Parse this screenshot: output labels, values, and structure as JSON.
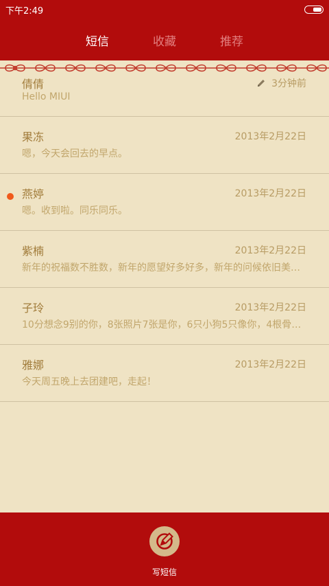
{
  "status_bar": {
    "time": "下午2:49"
  },
  "tabs": [
    {
      "label": "短信",
      "active": true
    },
    {
      "label": "收藏",
      "active": false
    },
    {
      "label": "推荐",
      "active": false
    }
  ],
  "conversations": [
    {
      "name": "倩倩",
      "time": "3分钟前",
      "preview": "Hello MIUI",
      "draft": true,
      "unread": false
    },
    {
      "name": "果冻",
      "time": "2013年2月22日",
      "preview": "嗯，今天会回去的早点。",
      "draft": false,
      "unread": false
    },
    {
      "name": "燕婷",
      "time": "2013年2月22日",
      "preview": "嗯。收到啦。同乐同乐。",
      "draft": false,
      "unread": true
    },
    {
      "name": "紫楠",
      "time": "2013年2月22日",
      "preview": "新年的祝福数不胜数，新年的愿望好多好多，新年的问候依旧美好…",
      "draft": false,
      "unread": false
    },
    {
      "name": "子玲",
      "time": "2013年2月22日",
      "preview": "10分想念9别的你，8张照片7张是你，6只小狗5只像你，4根骨头…",
      "draft": false,
      "unread": false
    },
    {
      "name": "雅娜",
      "time": "2013年2月22日",
      "preview": "今天周五晚上去团建吧，走起！",
      "draft": false,
      "unread": false
    }
  ],
  "bottom": {
    "compose_label": "写短信"
  },
  "colors": {
    "header_red": "#b20c0c",
    "background": "#efe3c4",
    "unread_dot": "#f05a1c"
  },
  "icons": {
    "draft": "pencil-icon",
    "compose": "compose-icon",
    "battery": "battery-icon"
  }
}
